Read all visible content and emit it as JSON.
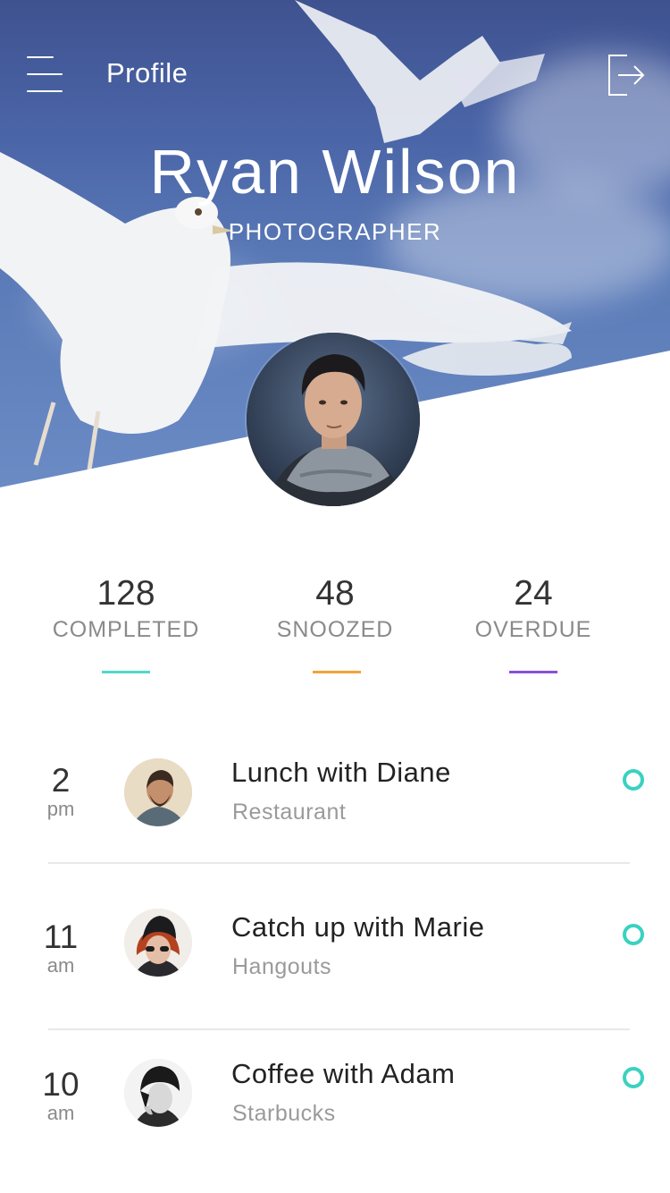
{
  "header": {
    "title": "Profile",
    "menu_icon": "menu-icon",
    "logout_icon": "logout-icon"
  },
  "profile": {
    "name": "Ryan Wilson",
    "role": "PHOTOGRAPHER"
  },
  "stats": [
    {
      "value": "128",
      "label": "COMPLETED",
      "color": "#4fd8c9"
    },
    {
      "value": "48",
      "label": "SNOOZED",
      "color": "#f2a23a"
    },
    {
      "value": "24",
      "label": "OVERDUE",
      "color": "#8b4fd8"
    }
  ],
  "agenda": [
    {
      "time": "2",
      "ampm": "pm",
      "title": "Lunch with Diane",
      "subtitle": "Restaurant",
      "status_color": "#3bd1c0"
    },
    {
      "time": "11",
      "ampm": "am",
      "title": "Catch up with Marie",
      "subtitle": "Hangouts",
      "status_color": "#3bd1c0"
    },
    {
      "time": "10",
      "ampm": "am",
      "title": "Coffee with Adam",
      "subtitle": "Starbucks",
      "status_color": "#3bd1c0"
    }
  ]
}
